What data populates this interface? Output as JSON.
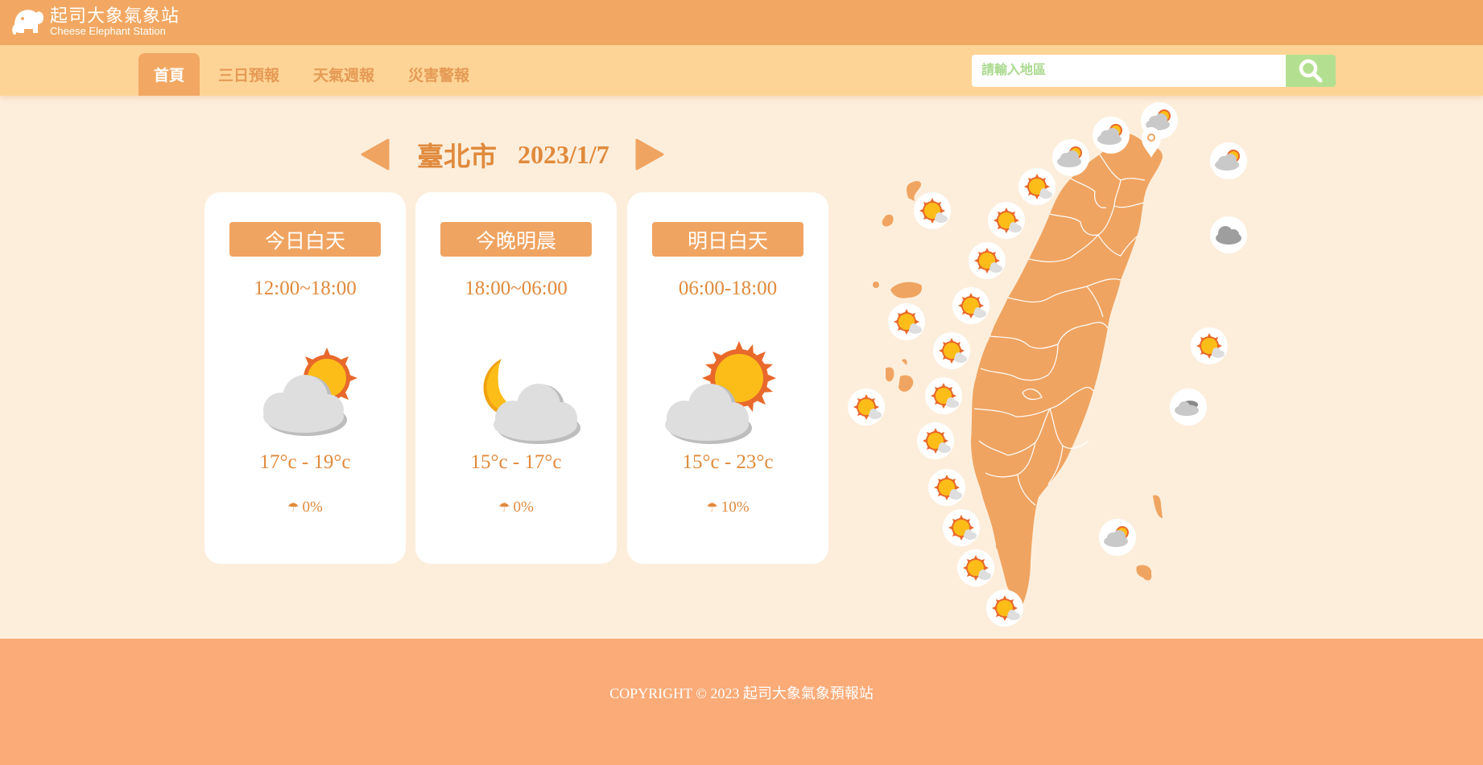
{
  "brand": {
    "title": "起司大象氣象站",
    "subtitle": "Cheese Elephant Station"
  },
  "nav": {
    "tabs": [
      {
        "label": "首頁",
        "active": true
      },
      {
        "label": "三日預報",
        "active": false
      },
      {
        "label": "天氣週報",
        "active": false
      },
      {
        "label": "災害警報",
        "active": false
      }
    ]
  },
  "search": {
    "placeholder": "請輸入地區",
    "icon": "search-icon"
  },
  "location": {
    "city": "臺北市",
    "date": "2023/1/7",
    "prev_icon": "triangle-left-icon",
    "next_icon": "triangle-right-icon"
  },
  "cards": [
    {
      "label": "今日白天",
      "time": "12:00~18:00",
      "icon": "partly-cloudy-day-icon",
      "temp": "17°c - 19°c",
      "rain": "0%"
    },
    {
      "label": "今晚明晨",
      "time": "18:00~06:00",
      "icon": "partly-cloudy-night-icon",
      "temp": "15°c - 17°c",
      "rain": "0%"
    },
    {
      "label": "明日白天",
      "time": "06:00-18:00",
      "icon": "mostly-sunny-icon",
      "temp": "15°c - 23°c",
      "rain": "10%"
    }
  ],
  "map": {
    "selected_marker": "location-pin-icon"
  },
  "footer": {
    "copyright": "COPYRIGHT © 2023 起司大象氣象預報站"
  },
  "colors": {
    "primary": "#f2a862",
    "nav": "#fed496",
    "background": "#fdeedc",
    "text_accent": "#e08a3c",
    "search_button": "#b3e090",
    "footer": "#fbab77"
  }
}
